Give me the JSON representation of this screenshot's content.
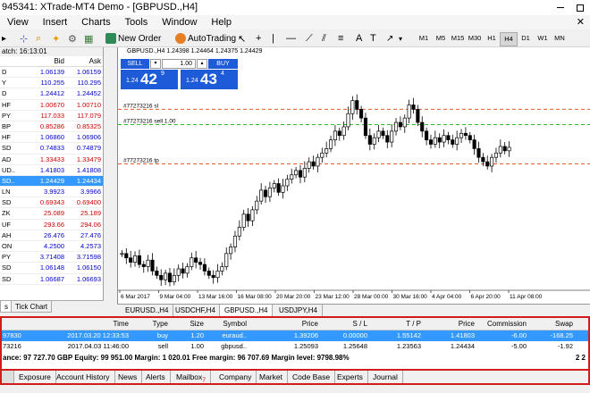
{
  "window": {
    "title": "945341: XTrade-MT4 Demo - [GBPUSD.,H4]"
  },
  "menu": [
    "View",
    "Insert",
    "Charts",
    "Tools",
    "Window",
    "Help"
  ],
  "toolbar": {
    "new_order": "New Order",
    "auto_trading": "AutoTrading",
    "timeframes": [
      "M1",
      "M5",
      "M15",
      "M30",
      "H1",
      "H4",
      "D1",
      "W1",
      "MN"
    ],
    "active_timeframe": "H4"
  },
  "market_watch": {
    "header": "atch: 16:13:01",
    "col_bid": "Bid",
    "col_ask": "Ask",
    "rows": [
      {
        "symbol": "D",
        "bid": "1.06139",
        "ask": "1.06159",
        "dir": "up"
      },
      {
        "symbol": "Y",
        "bid": "110.255",
        "ask": "110.295",
        "dir": "up"
      },
      {
        "symbol": "D",
        "bid": "1.24412",
        "ask": "1.24452",
        "dir": "up"
      },
      {
        "symbol": "HF",
        "bid": "1.00670",
        "ask": "1.00710",
        "dir": "dn"
      },
      {
        "symbol": "PY",
        "bid": "117.033",
        "ask": "117.079",
        "dir": "dn"
      },
      {
        "symbol": "BP",
        "bid": "0.85286",
        "ask": "0.85325",
        "dir": "dn"
      },
      {
        "symbol": "HF",
        "bid": "1.06860",
        "ask": "1.06906",
        "dir": "up"
      },
      {
        "symbol": "SD",
        "bid": "0.74833",
        "ask": "0.74879",
        "dir": "up"
      },
      {
        "symbol": "AD",
        "bid": "1.33433",
        "ask": "1.33479",
        "dir": "dn"
      },
      {
        "symbol": "UD..",
        "bid": "1.41803",
        "ask": "1.41808",
        "dir": "up"
      },
      {
        "symbol": "SD..",
        "bid": "1.24429",
        "ask": "1.24434",
        "dir": "up",
        "selected": true
      },
      {
        "symbol": "LN",
        "bid": "3.9923",
        "ask": "3.9966",
        "dir": "up"
      },
      {
        "symbol": "SD",
        "bid": "0.69343",
        "ask": "0.69400",
        "dir": "dn"
      },
      {
        "symbol": "ZK",
        "bid": "25.089",
        "ask": "25.189",
        "dir": "dn"
      },
      {
        "symbol": "UF",
        "bid": "293.66",
        "ask": "294.06",
        "dir": "dn"
      },
      {
        "symbol": "AH",
        "bid": "26.476",
        "ask": "27.476",
        "dir": "up"
      },
      {
        "symbol": "ON",
        "bid": "4.2500",
        "ask": "4.2573",
        "dir": "up"
      },
      {
        "symbol": "PY",
        "bid": "3.71408",
        "ask": "3.71598",
        "dir": "up"
      },
      {
        "symbol": "SD",
        "bid": "1.06148",
        "ask": "1.06150",
        "dir": "up"
      },
      {
        "symbol": "SD",
        "bid": "1.06687",
        "ask": "1.06693",
        "dir": "up"
      }
    ],
    "tabs": [
      "s",
      "Tick Chart"
    ]
  },
  "chart": {
    "info": "GBPUSD.,H4  1.24398 1.24464 1.24375 1.24429",
    "one_click": {
      "sell": "SELL",
      "buy": "BUY",
      "lot": "1.00",
      "sell_price_small": "1.24",
      "sell_price_big": "42",
      "sell_price_sup": "9",
      "buy_price_small": "1.24",
      "buy_price_big": "43",
      "buy_price_sup": "4"
    },
    "levels": [
      {
        "label": "#77273216 sl",
        "color": "#e85c2c"
      },
      {
        "label": "#77273216 sell 1.00",
        "color": "#2fbf2f"
      },
      {
        "label": "#77273216 tp",
        "color": "#e85c2c"
      }
    ],
    "x_labels": [
      "6 Mar 2017",
      "9 Mar 04:00",
      "13 Mar 16:00",
      "16 Mar 08:00",
      "20 Mar 20:00",
      "23 Mar 12:00",
      "28 Mar 00:00",
      "30 Mar 16:00",
      "4 Apr 04:00",
      "6 Apr 20:00",
      "11 Apr 08:00"
    ],
    "tabs": [
      "EURUSD.,H4",
      "USDCHF,H4",
      "GBPUSD.,H4",
      "USDJPY,H4"
    ],
    "active_tab": "GBPUSD.,H4"
  },
  "chart_data": {
    "type": "candlestick",
    "series": [
      {
        "name": "GBPUSD.,H4",
        "values": [
          1.22,
          1.219,
          1.218,
          1.2195,
          1.2175,
          1.217,
          1.2185,
          1.216,
          1.215,
          1.214,
          1.2155,
          1.2135,
          1.215,
          1.2165,
          1.2155,
          1.217,
          1.219,
          1.218,
          1.2175,
          1.216,
          1.215,
          1.2145,
          1.216,
          1.217,
          1.22,
          1.2215,
          1.224,
          1.226,
          1.229,
          1.2275,
          1.23,
          1.232,
          1.2345,
          1.233,
          1.235,
          1.236,
          1.234,
          1.2355,
          1.237,
          1.238,
          1.239,
          1.2375,
          1.2395,
          1.241,
          1.24,
          1.242,
          1.243,
          1.244,
          1.246,
          1.248,
          1.247,
          1.249,
          1.252,
          1.255,
          1.253,
          1.251,
          1.247,
          1.245,
          1.2465,
          1.248,
          1.247,
          1.2455,
          1.248,
          1.25,
          1.249,
          1.251,
          1.254,
          1.253,
          1.25,
          1.248,
          1.246,
          1.245,
          1.2465,
          1.2455,
          1.247,
          1.246,
          1.245,
          1.2465,
          1.2475,
          1.247,
          1.246,
          1.244,
          1.242,
          1.241,
          1.24,
          1.242,
          1.243,
          1.2445,
          1.2435,
          1.2443
        ]
      }
    ],
    "ylim": [
      1.212,
      1.259
    ],
    "x": [
      "6 Mar 2017",
      "9 Mar 04:00",
      "13 Mar 16:00",
      "16 Mar 08:00",
      "20 Mar 20:00",
      "23 Mar 12:00",
      "28 Mar 00:00",
      "30 Mar 16:00",
      "4 Apr 04:00",
      "6 Apr 20:00",
      "11 Apr 08:00"
    ],
    "levels": {
      "sl": 1.253,
      "entry": 1.2495,
      "tp": 1.2405
    }
  },
  "terminal": {
    "columns": [
      "Time",
      "Type",
      "Size",
      "Symbol",
      "Price",
      "S / L",
      "T / P",
      "Price",
      "Commission",
      "Swap"
    ],
    "rows": [
      {
        "order": "97830",
        "time": "2017.03.20 12:33:53",
        "type": "buy",
        "size": "1.20",
        "symbol": "euraud..",
        "price": "1.39206",
        "sl": "0.00000",
        "tp": "1.55142",
        "cur": "1.41803",
        "commission": "-6.00",
        "swap": "-168.25",
        "selected": true
      },
      {
        "order": "73216",
        "time": "2017.04.03 11:46:00",
        "type": "sell",
        "size": "1.00",
        "symbol": "gbpusd..",
        "price": "1.25093",
        "sl": "1.25648",
        "tp": "1.23563",
        "cur": "1.24434",
        "commission": "-5.00",
        "swap": "-1.92",
        "selected": false
      }
    ],
    "balance_line": "ance: 97 727.70 GBP  Equity: 99 951.00  Margin: 1 020.01  Free margin: 96 707.69  Margin level: 9798.98%",
    "balance_right": "2 2",
    "tabs": [
      "Exposure",
      "Account History",
      "News",
      "Alerts",
      "Mailbox",
      "Company",
      "Market",
      "Code Base",
      "Experts",
      "Journal"
    ],
    "mailbox_badge": "7"
  }
}
